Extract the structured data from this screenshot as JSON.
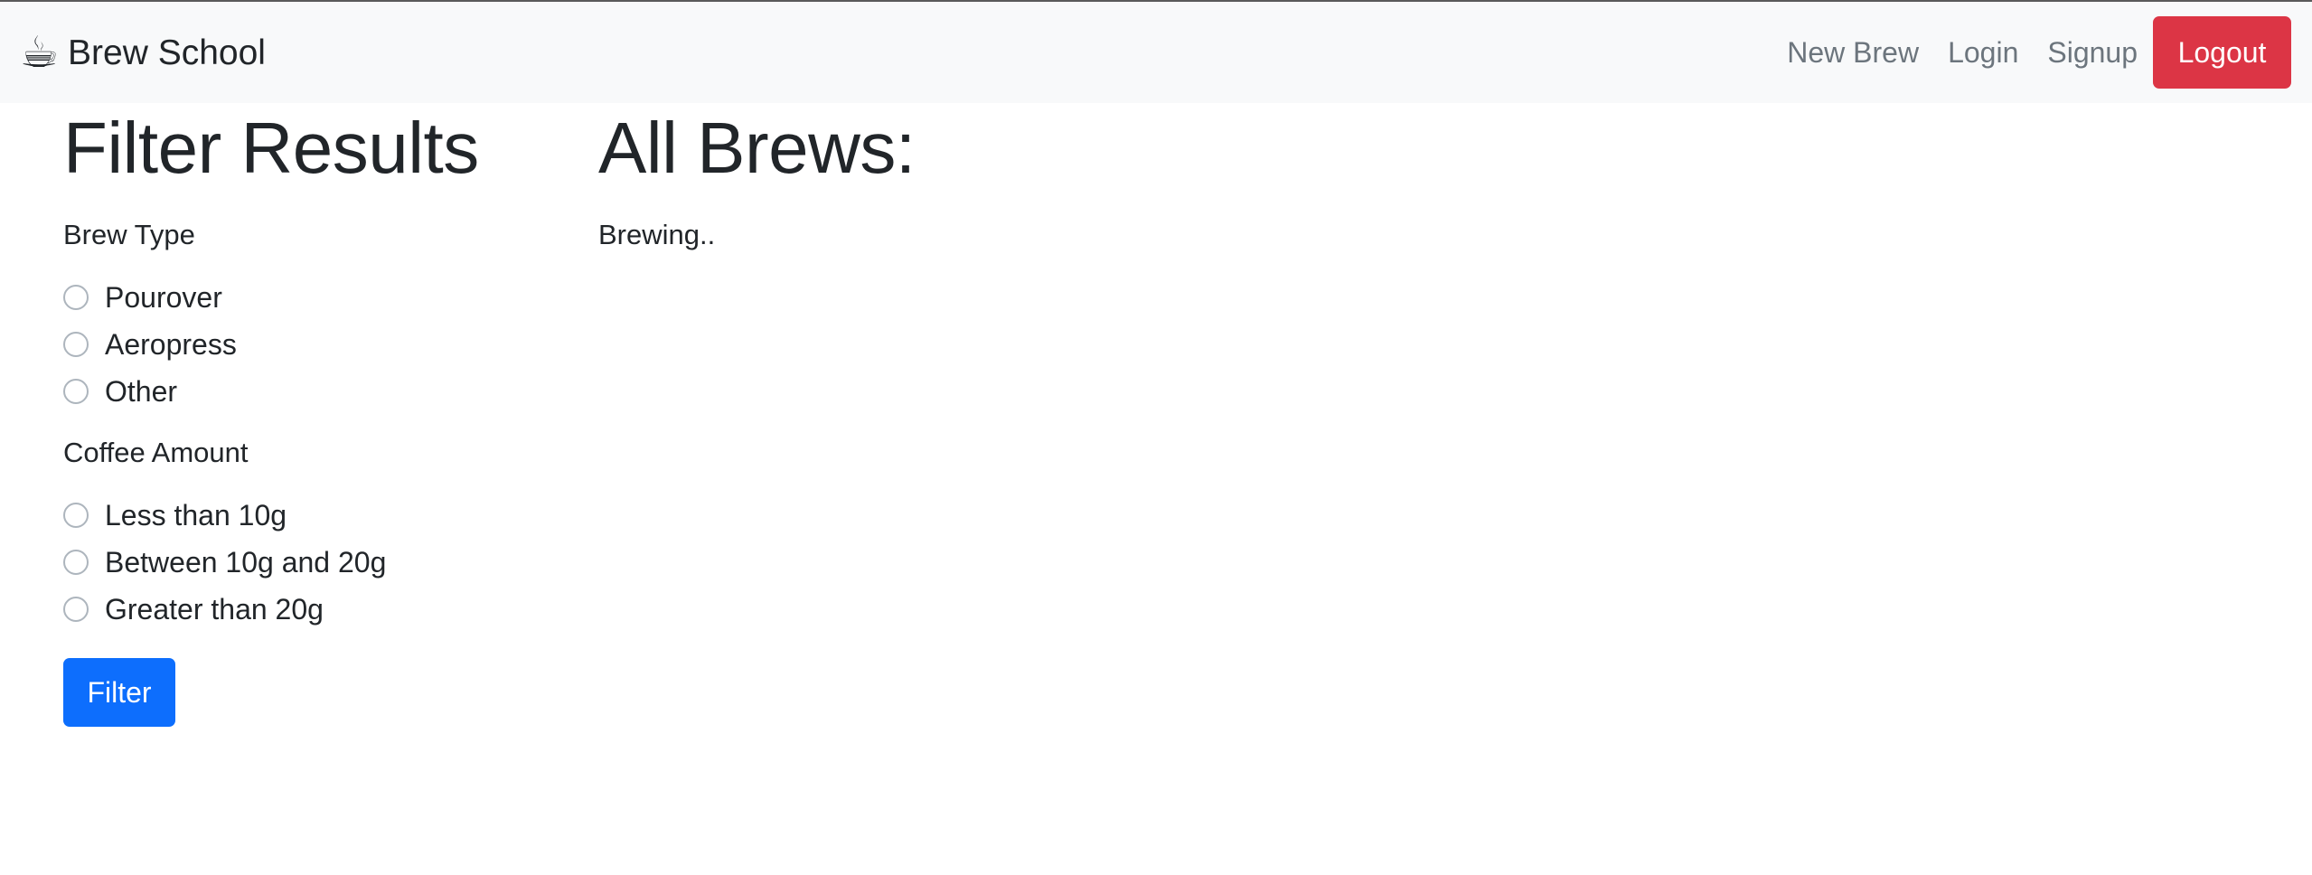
{
  "navbar": {
    "brand_icon": "☕",
    "brand_icon_name": "coffee-cup-icon",
    "brand_text": "Brew School",
    "links": [
      "New Brew",
      "Login",
      "Signup"
    ],
    "logout_label": "Logout",
    "logout_color": "#dc3545"
  },
  "filter": {
    "title": "Filter Results",
    "brew_type": {
      "label": "Brew Type",
      "options": [
        "Pourover",
        "Aeropress",
        "Other"
      ]
    },
    "coffee_amount": {
      "label": "Coffee Amount",
      "options": [
        "Less than 10g",
        "Between 10g and 20g",
        "Greater than 20g"
      ]
    },
    "button_label": "Filter",
    "button_color": "#0d6efd"
  },
  "brews": {
    "title": "All Brews:",
    "status": "Brewing.."
  }
}
